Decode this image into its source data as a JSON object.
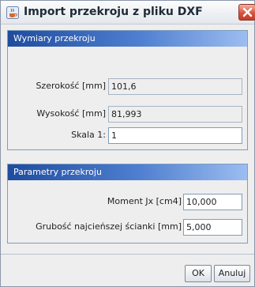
{
  "window": {
    "title": "Import przekroju z pliku DXF",
    "app_icon": "java-coffee-icon",
    "close_icon": "close-icon",
    "accent_color": "#d9533f"
  },
  "dimensions_group": {
    "title": "Wymiary przekroju",
    "header_color": "#1f4c9e",
    "width_label": "Szerokość [mm]",
    "width_value": "101,6",
    "height_label": "Wysokość [mm]",
    "height_value": "81,993",
    "scale_label": "Skala 1:",
    "scale_value": "1"
  },
  "params_group": {
    "title": "Parametry przekroju",
    "moment_label": "Moment Jx [cm4]",
    "moment_value": "10,000",
    "thickness_label": "Grubość najcieńszej ścianki [mm]",
    "thickness_value": "5,000"
  },
  "buttons": {
    "ok_label": "OK",
    "cancel_label": "Anuluj"
  }
}
